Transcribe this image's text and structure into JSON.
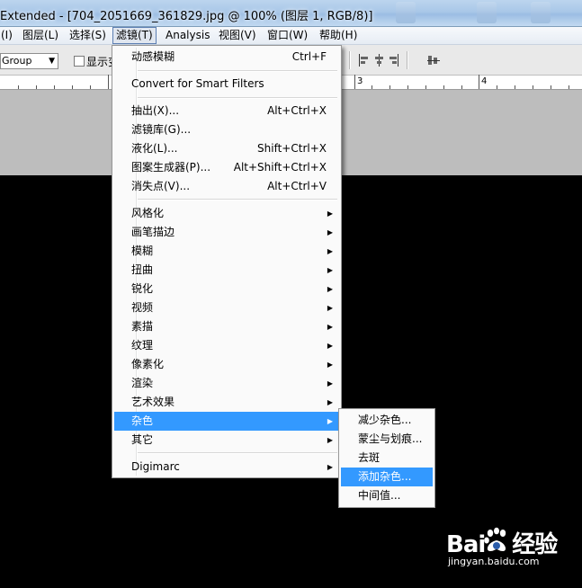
{
  "window": {
    "title": "Extended - [704_2051669_361829.jpg @ 100% (图层 1, RGB/8)]"
  },
  "menubar": {
    "items": [
      {
        "label": "(I)"
      },
      {
        "label": "图层(L)"
      },
      {
        "label": "选择(S)"
      },
      {
        "label": "滤镜(T)"
      },
      {
        "label": "Analysis"
      },
      {
        "label": "视图(V)"
      },
      {
        "label": "窗口(W)"
      },
      {
        "label": "帮助(H)"
      }
    ]
  },
  "options": {
    "auto_select_value": "Group",
    "show_checkbox_label": "显示变"
  },
  "ruler": {
    "labels": [
      "3",
      "4"
    ]
  },
  "filter_menu": {
    "items": [
      {
        "label": "动感模糊",
        "shortcut": "Ctrl+F"
      },
      {
        "label": "Convert for Smart Filters",
        "shortcut": ""
      },
      {
        "label": "抽出(X)...",
        "shortcut": "Alt+Ctrl+X"
      },
      {
        "label": "滤镜库(G)...",
        "shortcut": ""
      },
      {
        "label": "液化(L)...",
        "shortcut": "Shift+Ctrl+X"
      },
      {
        "label": "图案生成器(P)...",
        "shortcut": "Alt+Shift+Ctrl+X"
      },
      {
        "label": "消失点(V)...",
        "shortcut": "Alt+Ctrl+V"
      },
      {
        "label": "风格化",
        "shortcut": ""
      },
      {
        "label": "画笔描边",
        "shortcut": ""
      },
      {
        "label": "模糊",
        "shortcut": ""
      },
      {
        "label": "扭曲",
        "shortcut": ""
      },
      {
        "label": "锐化",
        "shortcut": ""
      },
      {
        "label": "视频",
        "shortcut": ""
      },
      {
        "label": "素描",
        "shortcut": ""
      },
      {
        "label": "纹理",
        "shortcut": ""
      },
      {
        "label": "像素化",
        "shortcut": ""
      },
      {
        "label": "渲染",
        "shortcut": ""
      },
      {
        "label": "艺术效果",
        "shortcut": ""
      },
      {
        "label": "杂色",
        "shortcut": ""
      },
      {
        "label": "其它",
        "shortcut": ""
      },
      {
        "label": "Digimarc",
        "shortcut": ""
      }
    ]
  },
  "noise_submenu": {
    "items": [
      {
        "label": "减少杂色..."
      },
      {
        "label": "蒙尘与划痕..."
      },
      {
        "label": "去斑"
      },
      {
        "label": "添加杂色..."
      },
      {
        "label": "中间值..."
      }
    ]
  },
  "watermark": {
    "brand_left": "Bai",
    "brand_right": "经验",
    "url": "jingyan.baidu.com"
  },
  "colors": {
    "highlight": "#3399ff",
    "canvas": "#000000",
    "pasteboard": "#bdbdbd"
  }
}
